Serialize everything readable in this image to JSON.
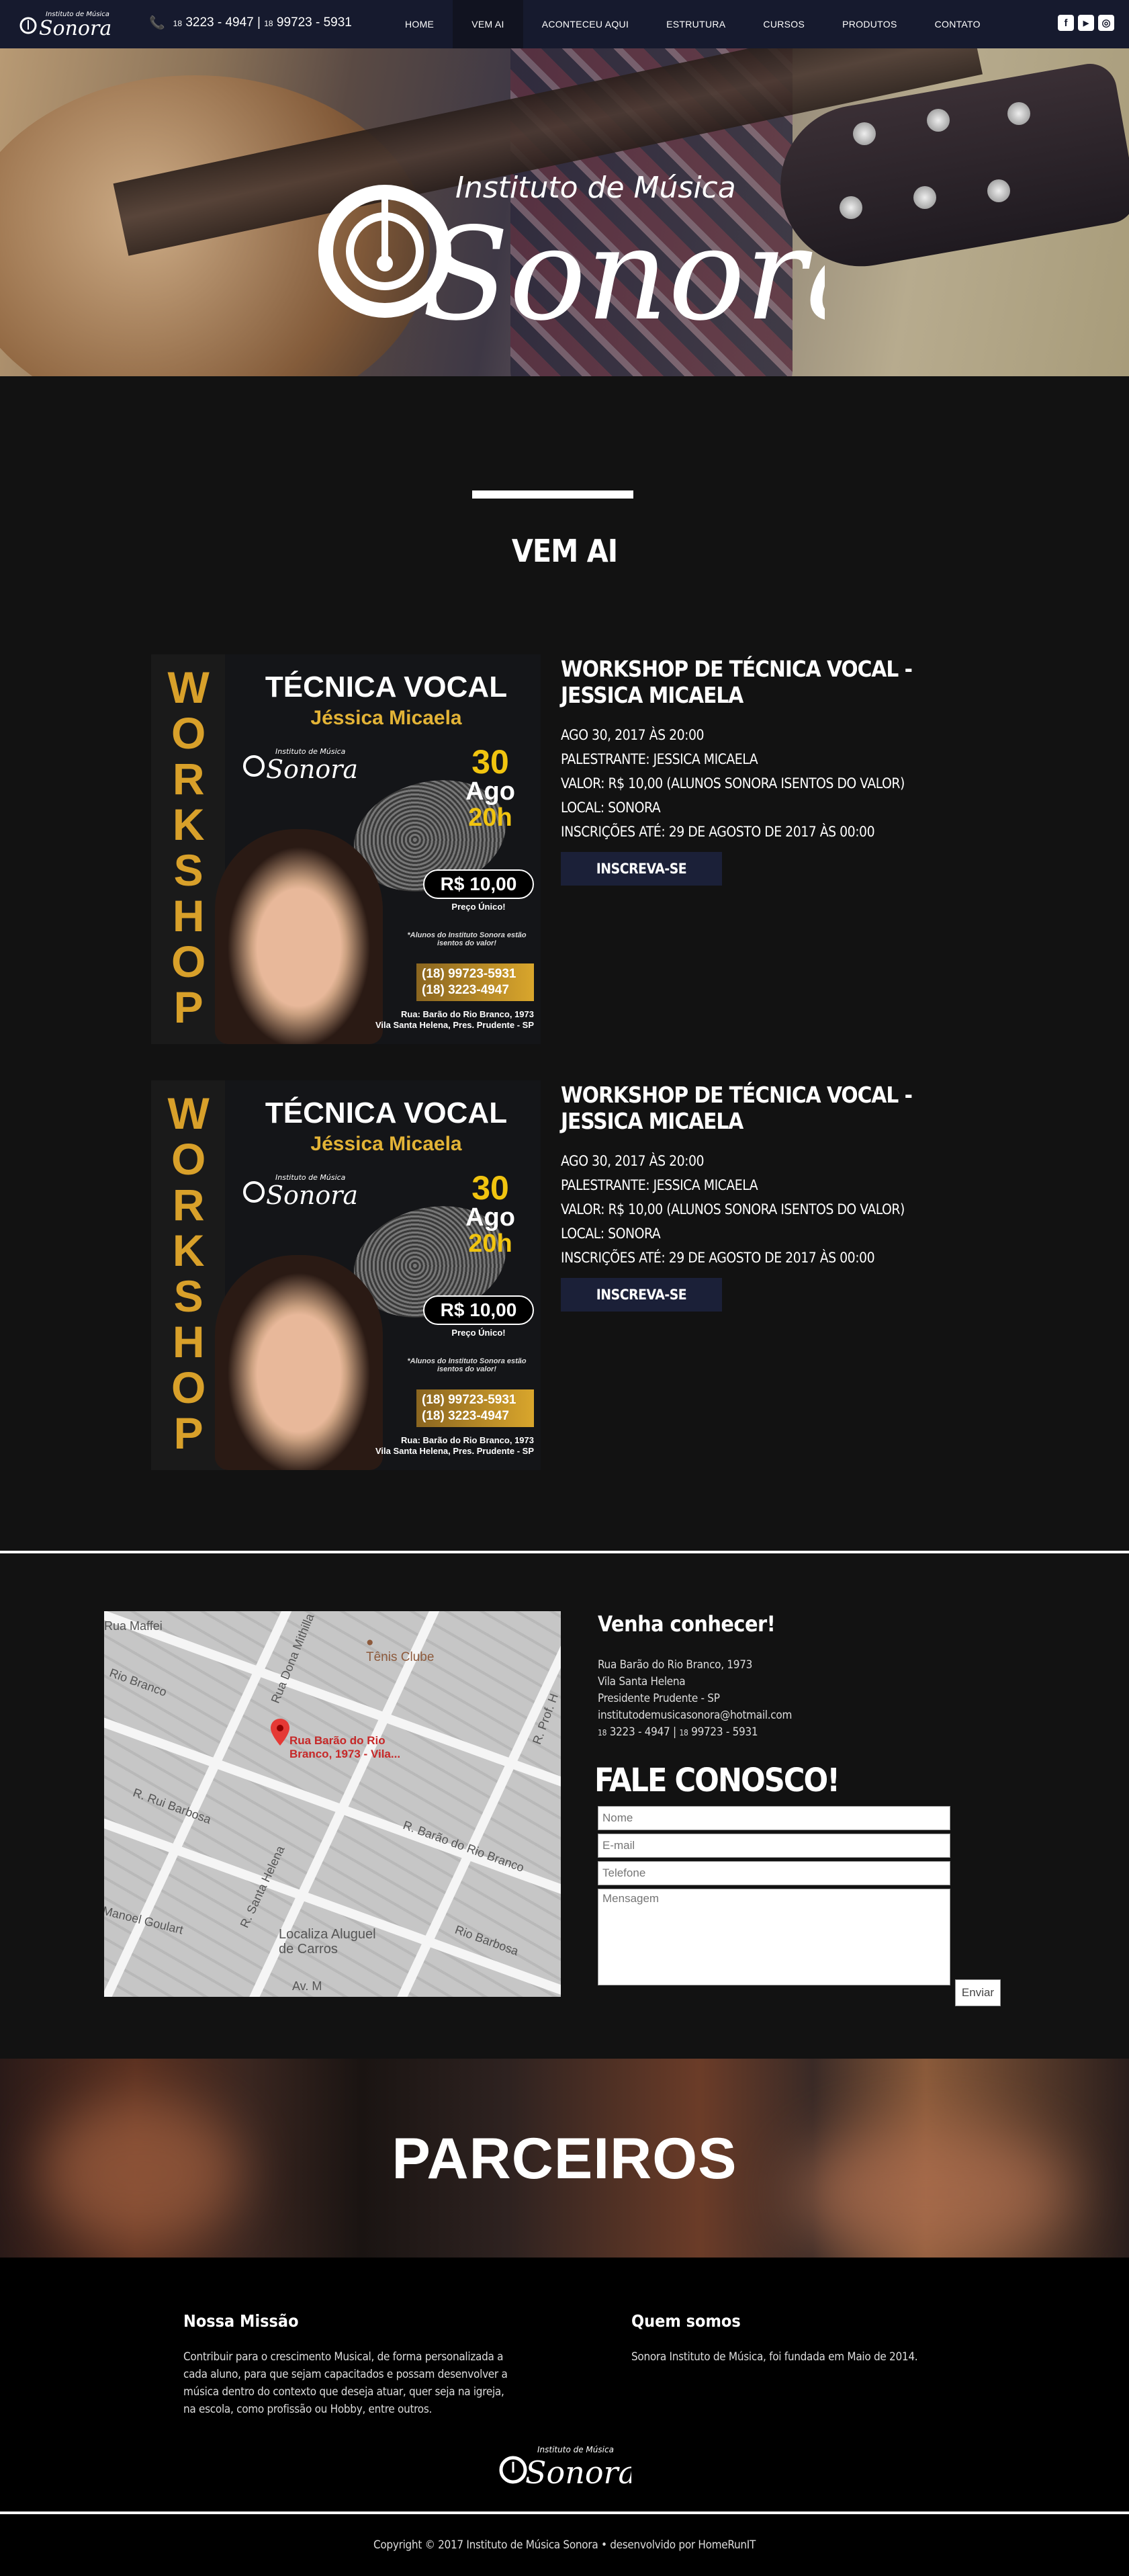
{
  "nav": {
    "logo_small": "Instituto de Música",
    "logo_big": "Sonora",
    "phone_prefix1": "18",
    "phone1": "3223 - 4947",
    "phone_prefix2": "18",
    "phone2": "99723 - 5931",
    "items": [
      {
        "label": "HOME"
      },
      {
        "label": "VEM AI"
      },
      {
        "label": "ACONTECEU AQUI"
      },
      {
        "label": "ESTRUTURA"
      },
      {
        "label": "CURSOS"
      },
      {
        "label": "PRODUTOS"
      },
      {
        "label": "CONTATO"
      }
    ],
    "social": [
      {
        "icon": "facebook-icon",
        "glyph": "f"
      },
      {
        "icon": "youtube-icon",
        "glyph": "▶"
      },
      {
        "icon": "instagram-icon",
        "glyph": "◎"
      }
    ]
  },
  "hero": {
    "logo_small": "Instituto de Música",
    "logo_big": "Sonora"
  },
  "section": {
    "title": "VEM AI"
  },
  "events": [
    {
      "poster": {
        "vertical_word": "WORKSHOP",
        "title": "TÉCNICA VOCAL",
        "name": "Jéssica Micaela",
        "logo_small": "Instituto de Música",
        "logo_big": "Sonora",
        "day": "30",
        "month": "Ago",
        "hour": "20h",
        "price": "R$ 10,00",
        "price_note": "Preço Único!",
        "note": "*Alunos do Instituto Sonora estão isentos do valor!",
        "phone1": "(18) 99723-5931",
        "phone2": "(18) 3223-4947",
        "address1": "Rua: Barão do Rio Branco, 1973",
        "address2": "Vila Santa Helena, Pres. Prudente - SP"
      },
      "title": "WORKSHOP DE TÉCNICA VOCAL - JESSICA MICAELA",
      "date": "AGO 30, 2017 ÀS 20:00",
      "speaker": "PALESTRANTE: JESSICA MICAELA",
      "price": "VALOR: R$ 10,00 (ALUNOS SONORA ISENTOS DO VALOR)",
      "place": "LOCAL: SONORA",
      "deadline": "INSCRIÇÕES ATÉ: 29 DE AGOSTO DE 2017 ÀS 00:00",
      "button": "INSCREVA-SE"
    },
    {
      "poster": {
        "vertical_word": "WORKSHOP",
        "title": "TÉCNICA VOCAL",
        "name": "Jéssica Micaela",
        "logo_small": "Instituto de Música",
        "logo_big": "Sonora",
        "day": "30",
        "month": "Ago",
        "hour": "20h",
        "price": "R$ 10,00",
        "price_note": "Preço Único!",
        "note": "*Alunos do Instituto Sonora estão isentos do valor!",
        "phone1": "(18) 99723-5931",
        "phone2": "(18) 3223-4947",
        "address1": "Rua: Barão do Rio Branco, 1973",
        "address2": "Vila Santa Helena, Pres. Prudente - SP"
      },
      "title": "WORKSHOP DE TÉCNICA VOCAL - JESSICA MICAELA",
      "date": "AGO 30, 2017 ÀS 20:00",
      "speaker": "PALESTRANTE: JESSICA MICAELA",
      "price": "VALOR: R$ 10,00 (ALUNOS SONORA ISENTOS DO VALOR)",
      "place": "LOCAL: SONORA",
      "deadline": "INSCRIÇÕES ATÉ: 29 DE AGOSTO DE 2017 ÀS 00:00",
      "button": "INSCREVA-SE"
    }
  ],
  "map": {
    "pin_label1": "Rua Barão do Rio",
    "pin_label2": "Branco, 1973 - Vila...",
    "tenis": "Tênis Clube",
    "loc1": "Localiza Aluguel",
    "loc2": "de Carros",
    "streets": [
      "Rua Maffei",
      "Rio Branco",
      "Rua Dona Mithilla",
      "R. Rui Barbosa",
      "R. Barão do Rio Branco",
      "Manoel Goulart",
      "R. Santa Helena",
      "Rio Barbosa",
      "Av. M",
      "R. Prof. H"
    ]
  },
  "contact": {
    "heading": "Venha conhecer!",
    "address_lines": [
      "Rua Barão do Rio Branco, 1973",
      "Vila Santa Helena",
      "Presidente Prudente - SP",
      "institutodemusicasonora@hotmail.com"
    ],
    "phone_prefix1": "18",
    "phone1": "3223 - 4947",
    "phone_prefix2": "18",
    "phone2": "99723 - 5931",
    "form_title": "FALE CONOSCO!",
    "name_placeholder": "Nome",
    "email_placeholder": "E-mail",
    "phone_placeholder": "Telefone",
    "message_placeholder": "Mensagem",
    "send": "Enviar"
  },
  "partners": {
    "title": "PARCEIROS"
  },
  "footer": {
    "mission_title": "Nossa Missão",
    "mission_text": "Contribuir para o crescimento Musical, de forma personalizada a cada aluno, para que sejam capacitados e possam desenvolver a música dentro do contexto que deseja atuar, quer seja na igreja, na escola, como profissão ou Hobby, entre outros.",
    "about_title": "Quem somos",
    "about_text": "Sonora Instituto de Música, foi fundada em Maio de 2014.",
    "logo_small": "Instituto de Música",
    "logo_big": "Sonora",
    "copyright": "Copyright © 2017 Instituto de Música Sonora  •  desenvolvido por HomeRunIT"
  }
}
